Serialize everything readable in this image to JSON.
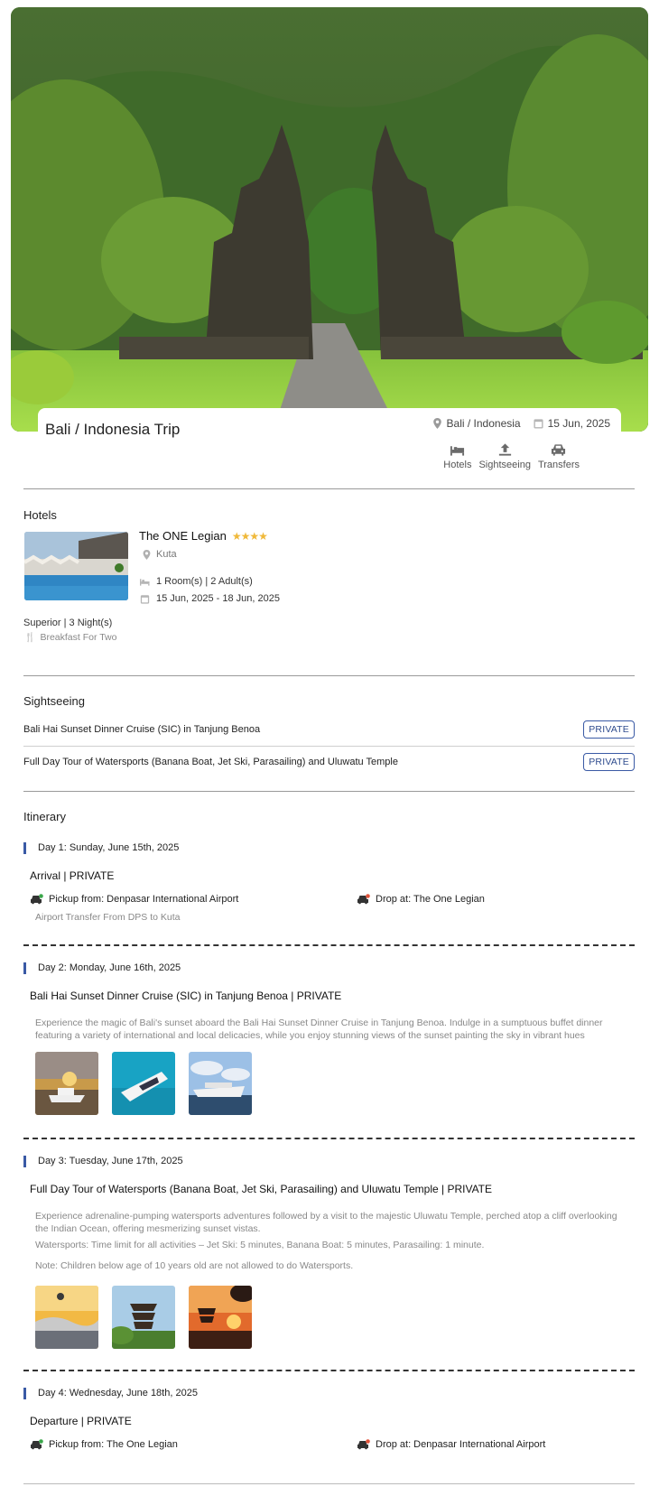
{
  "trip": {
    "title": "Bali / Indonesia Trip",
    "destination": "Bali / Indonesia",
    "date": "15 Jun, 2025",
    "services": [
      {
        "label": "Hotels",
        "icon": "bed-icon"
      },
      {
        "label": "Sightseeing",
        "icon": "upload-icon"
      },
      {
        "label": "Transfers",
        "icon": "car-icon"
      }
    ]
  },
  "hotels": {
    "section_title": "Hotels",
    "name": "The ONE Legian",
    "stars": "★★★★",
    "location": "Kuta",
    "rooms": "1 Room(s) | 2 Adult(s)",
    "dates": "15 Jun, 2025 - 18 Jun, 2025",
    "room_type": "Superior | 3 Night(s)",
    "meal": "Breakfast For Two"
  },
  "sightseeing": {
    "section_title": "Sightseeing",
    "items": [
      {
        "name": "Bali Hai Sunset Dinner Cruise (SIC) in Tanjung Benoa",
        "badge": "PRIVATE"
      },
      {
        "name": "Full Day Tour of Watersports (Banana Boat, Jet Ski, Parasailing) and Uluwatu Temple",
        "badge": "PRIVATE"
      }
    ]
  },
  "itinerary": {
    "section_title": "Itinerary",
    "days": [
      {
        "heading": "Day 1: Sunday, June 15th, 2025",
        "title": "Arrival | PRIVATE",
        "pickup": "Pickup from: Denpasar International Airport",
        "drop": "Drop at: The One Legian",
        "note": "Airport Transfer From DPS to Kuta"
      },
      {
        "heading": "Day 2: Monday, June 16th, 2025",
        "title": "Bali Hai Sunset Dinner Cruise (SIC) in Tanjung Benoa | PRIVATE",
        "desc": "Experience the magic of Bali's sunset aboard the Bali Hai Sunset Dinner Cruise in Tanjung Benoa. Indulge in a sumptuous buffet dinner featuring a variety of international and local delicacies, while you enjoy stunning views of the sunset painting the sky in vibrant hues"
      },
      {
        "heading": "Day 3: Tuesday, June 17th, 2025",
        "title": "Full Day Tour of Watersports (Banana Boat, Jet Ski, Parasailing) and Uluwatu Temple | PRIVATE",
        "desc": "Experience adrenaline-pumping watersports adventures followed by a visit to the majestic Uluwatu Temple, perched atop a cliff overlooking the Indian Ocean, offering mesmerizing sunset vistas.",
        "desc2": "Watersports: Time limit for all activities – Jet Ski: 5 minutes, Banana Boat: 5 minutes, Parasailing: 1 minute.",
        "desc3": "Note: Children below age of 10 years old are not allowed to do Watersports."
      },
      {
        "heading": "Day 4: Wednesday, June 18th, 2025",
        "title": "Departure | PRIVATE",
        "pickup": "Pickup from: The One Legian",
        "drop": "Drop at: Denpasar International Airport"
      }
    ]
  },
  "colors": {
    "accent": "#3a5aa5",
    "star": "#f0b93a",
    "muted_text": "#888888"
  }
}
